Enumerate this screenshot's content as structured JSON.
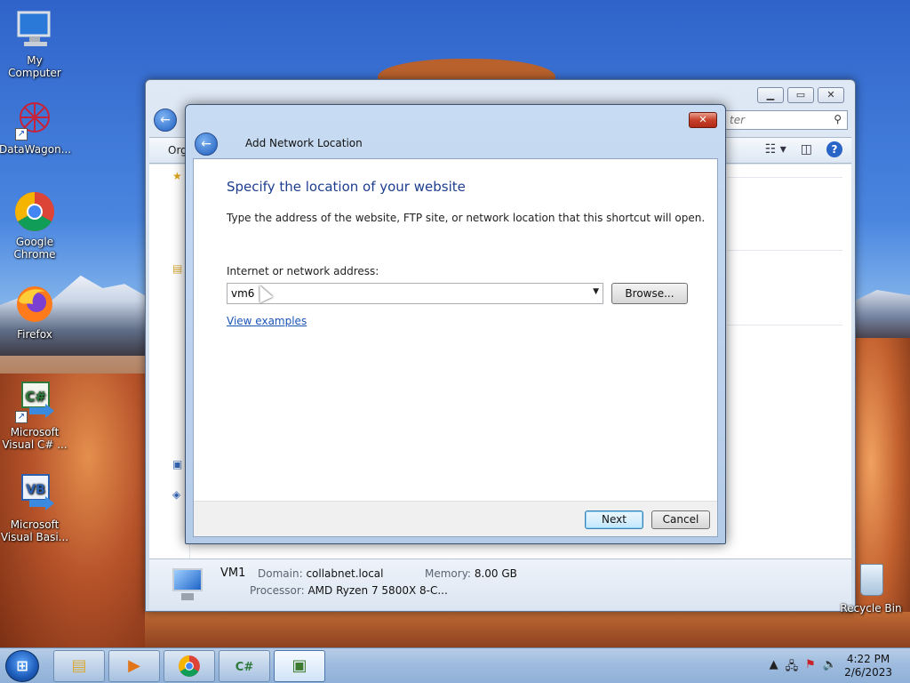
{
  "desktop": {
    "icons": [
      {
        "label_1": "My Computer",
        "label_2": "",
        "icon": "computer-icon"
      },
      {
        "label_1": "DataWagon...",
        "label_2": "",
        "icon": "datawagon-icon"
      },
      {
        "label_1": "Google",
        "label_2": "Chrome",
        "icon": "chrome-icon"
      },
      {
        "label_1": "Firefox",
        "label_2": "",
        "icon": "firefox-icon"
      },
      {
        "label_1": "Microsoft",
        "label_2": "Visual C# ...",
        "icon": "visual-csharp-icon"
      },
      {
        "label_1": "Microsoft",
        "label_2": "Visual Basi...",
        "icon": "visual-basic-icon"
      }
    ],
    "recycle_bin": "Recycle Bin",
    "csharp_glyph": "C#",
    "vb_glyph": "VB"
  },
  "explorer": {
    "search_placeholder": "ter",
    "toolbar_label": "Org",
    "status": {
      "name": "VM1",
      "domain_key": "Domain:",
      "domain_val": "collabnet.local",
      "memory_key": "Memory:",
      "memory_val": "8.00 GB",
      "processor_key": "Processor:",
      "processor_val": "AMD Ryzen 7 5800X 8-C..."
    }
  },
  "dialog": {
    "window_title": "Add Network Location",
    "heading": "Specify the location of your website",
    "description": "Type the address of the website, FTP site, or network location that this shortcut will open.",
    "address_label": "Internet or network address:",
    "address_value": "vm6",
    "browse_label": "Browse...",
    "view_examples": "View examples",
    "next_label": "Next",
    "cancel_label": "Cancel"
  },
  "taskbar": {
    "buttons": [
      "file-explorer-icon",
      "media-player-icon",
      "chrome-icon",
      "visual-csharp-icon",
      "network-location-icon"
    ],
    "time": "4:22 PM",
    "date": "2/6/2023"
  },
  "colors": {
    "heading_blue": "#1e3d8f",
    "link_blue": "#1a55b8",
    "close_red": "#c7402a"
  }
}
